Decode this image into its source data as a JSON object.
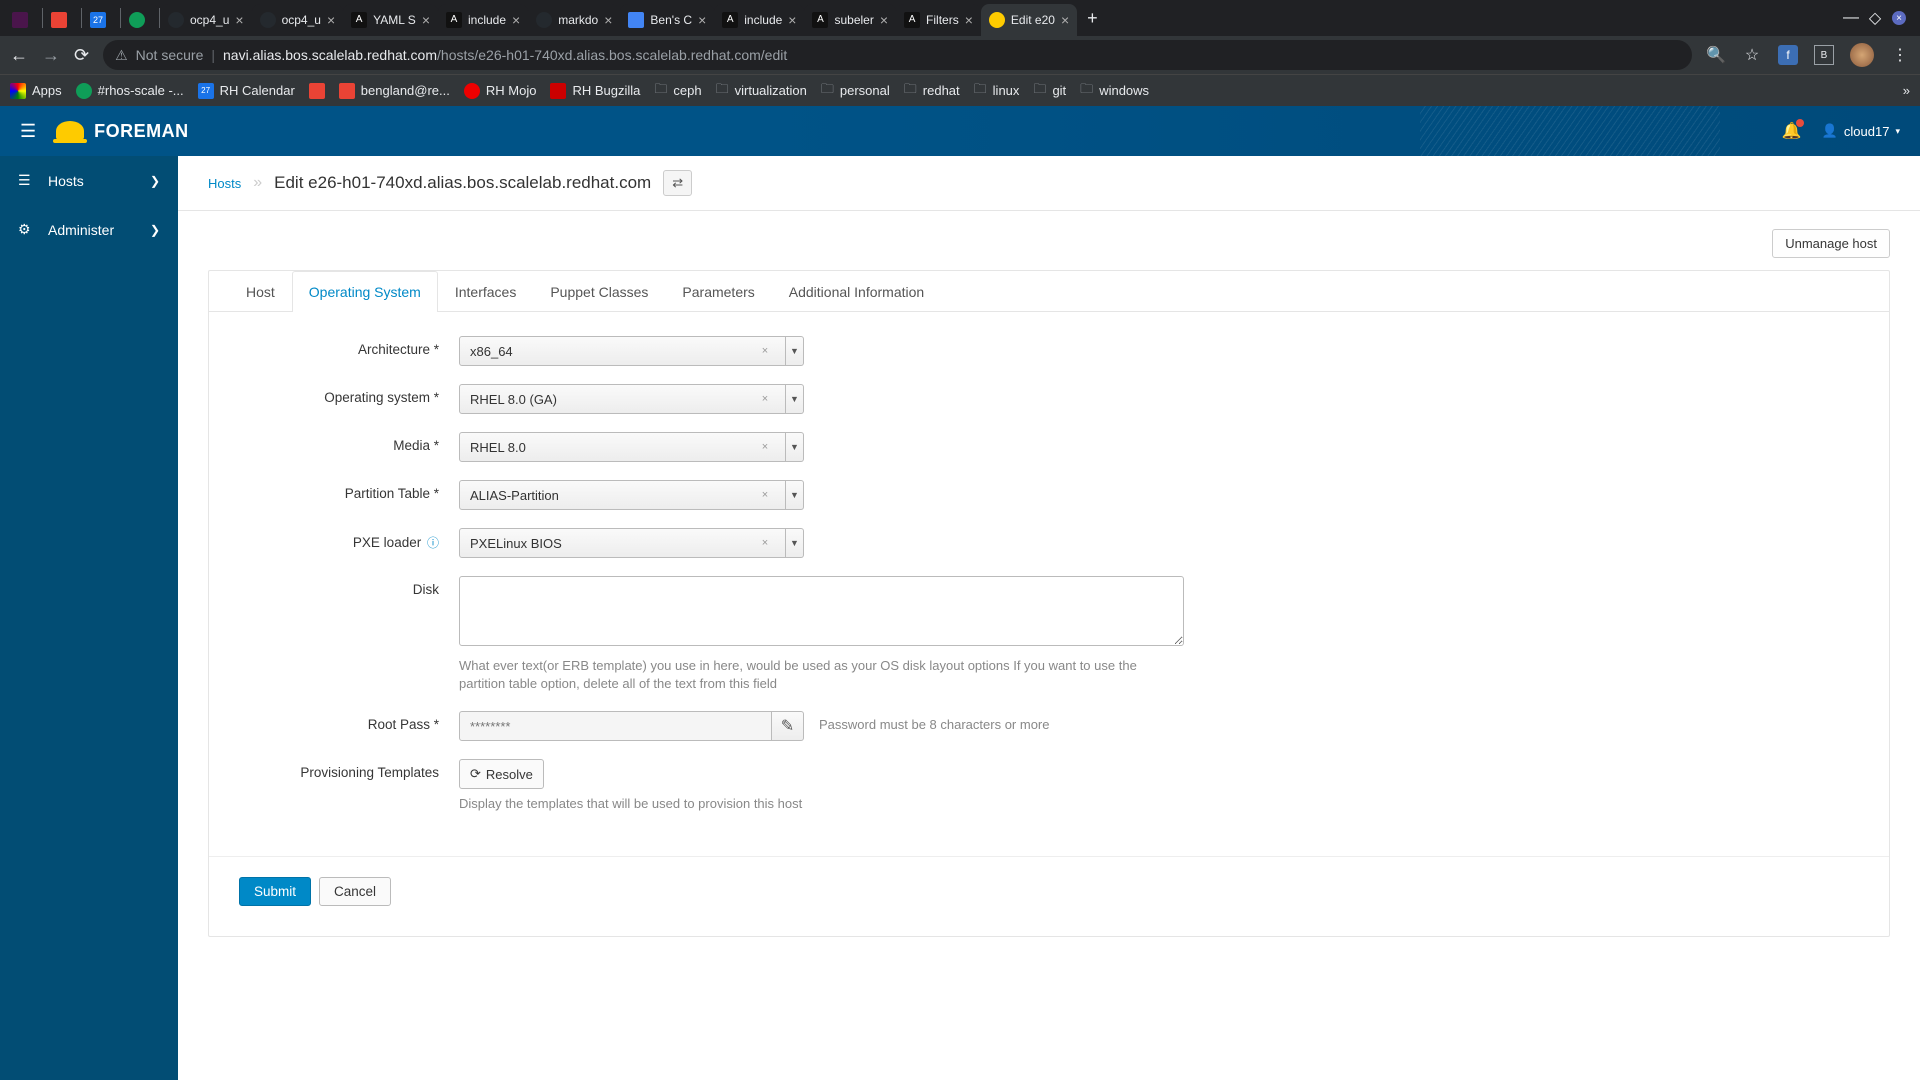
{
  "browser": {
    "tabs": [
      {
        "title": "",
        "icon_bg": "#4a154b"
      },
      {
        "title": "",
        "icon_bg": "#ea4335"
      },
      {
        "title": "",
        "icon_bg": "#1a73e8"
      },
      {
        "title": "",
        "icon_bg": "#0f9d58"
      },
      {
        "title": "ocp4_u",
        "icon_bg": "#24292e"
      },
      {
        "title": "ocp4_u",
        "icon_bg": "#24292e"
      },
      {
        "title": "YAML S",
        "icon_bg": "#111"
      },
      {
        "title": "include",
        "icon_bg": "#111"
      },
      {
        "title": "markdo",
        "icon_bg": "#24292e"
      },
      {
        "title": "Ben's C",
        "icon_bg": "#4285f4"
      },
      {
        "title": "include",
        "icon_bg": "#111"
      },
      {
        "title": "subeler",
        "icon_bg": "#111"
      },
      {
        "title": "Filters",
        "icon_bg": "#111"
      },
      {
        "title": "Edit e20",
        "icon_bg": "#fecb00",
        "active": true
      }
    ],
    "url_insecure": "Not secure",
    "url_host": "navi.alias.bos.scalelab.redhat.com",
    "url_path": "/hosts/e26-h01-740xd.alias.bos.scalelab.redhat.com/edit",
    "bookmarks": [
      {
        "label": "Apps",
        "icon": "grid"
      },
      {
        "label": "#rhos-scale -...",
        "icon_bg": "#0f9d58"
      },
      {
        "label": "RH Calendar",
        "icon_bg": "#1a73e8"
      },
      {
        "label": "",
        "icon_bg": "#ea4335"
      },
      {
        "label": "bengland@re...",
        "icon_bg": "#ea4335"
      },
      {
        "label": "RH Mojo",
        "icon_bg": "#ee0000"
      },
      {
        "label": "RH Bugzilla",
        "icon_bg": "#cc0000"
      },
      {
        "label": "ceph",
        "folder": true
      },
      {
        "label": "virtualization",
        "folder": true
      },
      {
        "label": "personal",
        "folder": true
      },
      {
        "label": "redhat",
        "folder": true
      },
      {
        "label": "linux",
        "folder": true
      },
      {
        "label": "git",
        "folder": true
      },
      {
        "label": "windows",
        "folder": true
      }
    ]
  },
  "header": {
    "brand": "FOREMAN",
    "user": "cloud17"
  },
  "sidebar": {
    "items": [
      {
        "label": "Hosts",
        "icon": "server"
      },
      {
        "label": "Administer",
        "icon": "gear"
      }
    ]
  },
  "breadcrumb": {
    "root": "Hosts",
    "title": "Edit e26-h01-740xd.alias.bos.scalelab.redhat.com"
  },
  "actions": {
    "unmanage": "Unmanage host"
  },
  "tabs": [
    "Host",
    "Operating System",
    "Interfaces",
    "Puppet Classes",
    "Parameters",
    "Additional Information"
  ],
  "form": {
    "architecture": {
      "label": "Architecture *",
      "value": "x86_64"
    },
    "os": {
      "label": "Operating system *",
      "value": "RHEL 8.0 (GA)"
    },
    "media": {
      "label": "Media *",
      "value": "RHEL 8.0"
    },
    "partition": {
      "label": "Partition Table *",
      "value": "ALIAS-Partition"
    },
    "pxe": {
      "label": "PXE loader",
      "value": "PXELinux BIOS"
    },
    "disk": {
      "label": "Disk",
      "helper": "What ever text(or ERB template) you use in here, would be used as your OS disk layout options If you want to use the partition table option, delete all of the text from this field"
    },
    "rootpass": {
      "label": "Root Pass *",
      "placeholder": "********",
      "hint": "Password must be 8 characters or more"
    },
    "provisioning": {
      "label": "Provisioning Templates",
      "button": "Resolve",
      "helper": "Display the templates that will be used to provision this host"
    }
  },
  "buttons": {
    "submit": "Submit",
    "cancel": "Cancel"
  }
}
